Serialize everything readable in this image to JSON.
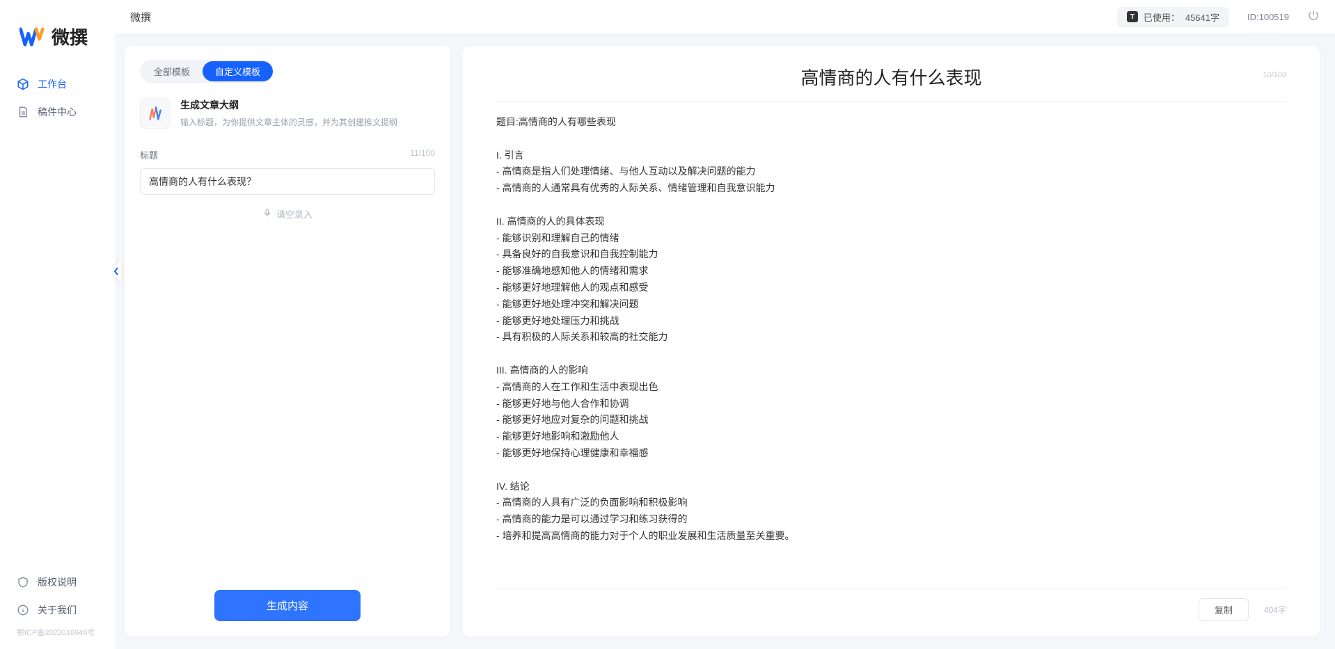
{
  "brand": {
    "name": "微撰"
  },
  "sidebar": {
    "nav": [
      {
        "label": "工作台",
        "active": true
      },
      {
        "label": "稿件中心",
        "active": false
      }
    ],
    "bottom": [
      {
        "label": "版权说明"
      },
      {
        "label": "关于我们"
      }
    ],
    "icp": "鄂ICP备2022016946号"
  },
  "topbar": {
    "title": "微撰",
    "usage_prefix": "已使用：",
    "usage_value": "45641字",
    "id_label": "ID:100519"
  },
  "left_panel": {
    "tabs": [
      {
        "label": "全部模板",
        "active": false
      },
      {
        "label": "自定义模板",
        "active": true
      }
    ],
    "template": {
      "title": "生成文章大纲",
      "desc": "输入标题，为你提供文章主体的灵感，并为其创建推文提纲"
    },
    "field_label": "标题",
    "char_counter": "11/100",
    "input_value": "高情商的人有什么表现？",
    "voice_label": "请空录入",
    "generate_label": "生成内容"
  },
  "right_panel": {
    "title": "高情商的人有什么表现",
    "title_counter": "10/100",
    "body": "题目:高情商的人有哪些表现\n\nI. 引言\n- 高情商是指人们处理情绪、与他人互动以及解决问题的能力\n- 高情商的人通常具有优秀的人际关系、情绪管理和自我意识能力\n\nII. 高情商的人的具体表现\n- 能够识别和理解自己的情绪\n- 具备良好的自我意识和自我控制能力\n- 能够准确地感知他人的情绪和需求\n- 能够更好地理解他人的观点和感受\n- 能够更好地处理冲突和解决问题\n- 能够更好地处理压力和挑战\n- 具有积极的人际关系和较高的社交能力\n\nIII. 高情商的人的影响\n- 高情商的人在工作和生活中表现出色\n- 能够更好地与他人合作和协调\n- 能够更好地应对复杂的问题和挑战\n- 能够更好地影响和激励他人\n- 能够更好地保持心理健康和幸福感\n\nIV. 结论\n- 高情商的人具有广泛的负面影响和积极影响\n- 高情商的能力是可以通过学习和练习获得的\n- 培养和提高高情商的能力对于个人的职业发展和生活质量至关重要。",
    "copy_label": "复制",
    "word_count": "404字"
  }
}
